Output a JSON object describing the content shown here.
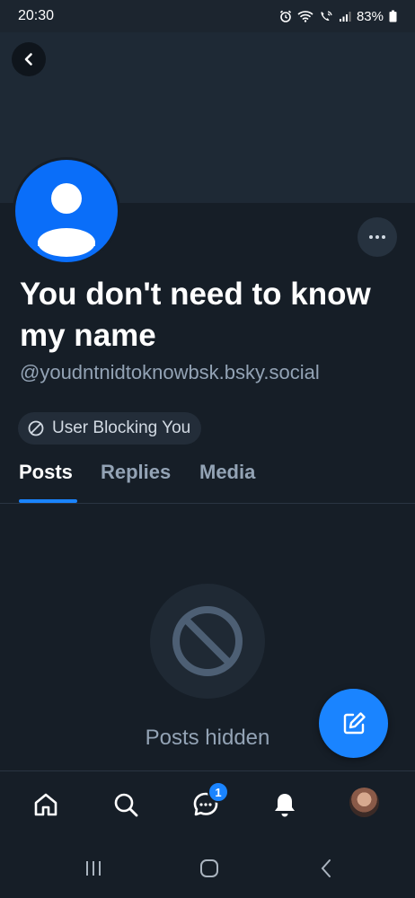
{
  "status_bar": {
    "time": "20:30",
    "battery": "83%"
  },
  "profile": {
    "display_name": "You don't need to know my name",
    "handle": "@youdntnidtoknowbsk.bsky.social",
    "block_badge": "User Blocking You"
  },
  "tabs": [
    {
      "label": "Posts",
      "active": true
    },
    {
      "label": "Replies",
      "active": false
    },
    {
      "label": "Media",
      "active": false
    }
  ],
  "empty_state": {
    "label": "Posts hidden"
  },
  "bottom_nav": {
    "chat_badge": "1"
  },
  "colors": {
    "accent": "#1a84ff",
    "background": "#161e27",
    "muted_text": "#93a3b5"
  }
}
